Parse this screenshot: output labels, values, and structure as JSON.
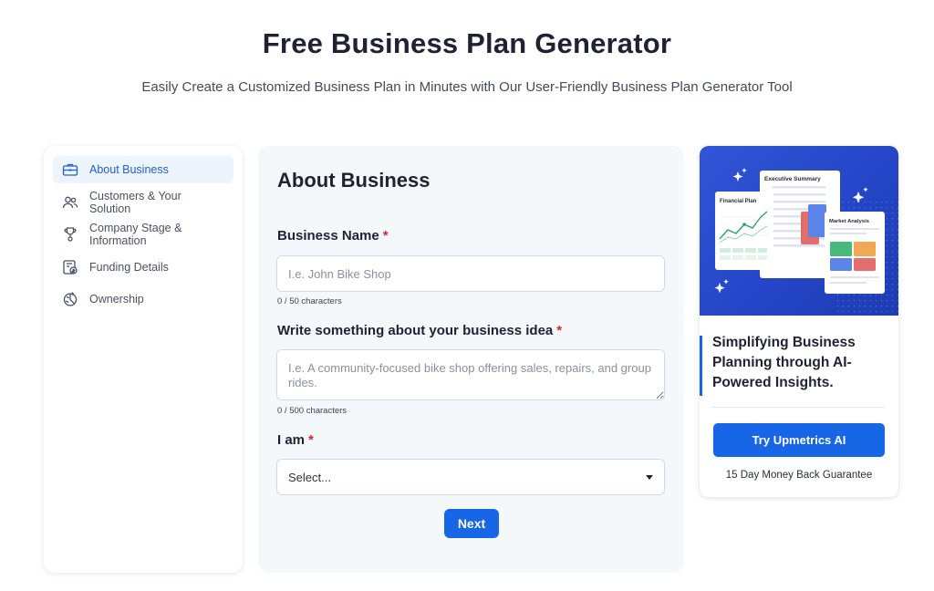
{
  "header": {
    "title": "Free Business Plan Generator",
    "subtitle": "Easily Create a Customized Business Plan in Minutes with Our User-Friendly Business Plan Generator Tool"
  },
  "sidebar": {
    "items": [
      {
        "label": "About Business",
        "icon": "briefcase-icon",
        "active": true
      },
      {
        "label": "Customers & Your Solution",
        "icon": "users-icon",
        "active": false
      },
      {
        "label": "Company Stage & Information",
        "icon": "trophy-icon",
        "active": false
      },
      {
        "label": "Funding Details",
        "icon": "funding-icon",
        "active": false
      },
      {
        "label": "Ownership",
        "icon": "ownership-icon",
        "active": false
      }
    ]
  },
  "form": {
    "title": "About Business",
    "required_marker": "*",
    "business_name": {
      "label": "Business Name",
      "placeholder": "I.e. John Bike Shop",
      "value": "",
      "counter": "0 / 50 characters"
    },
    "business_idea": {
      "label": "Write something about your business idea",
      "placeholder": "I.e. A community-focused bike shop offering sales, repairs, and group rides.",
      "value": "",
      "counter": "0 / 500 characters"
    },
    "i_am": {
      "label": "I am",
      "selected": "Select..."
    },
    "next_label": "Next"
  },
  "promo": {
    "illustration": {
      "executive_summary": "Executive Summary",
      "financial_plan": "Financial Plan",
      "market_analysis": "Market Analysis"
    },
    "heading": "Simplifying Business Planning through AI-Powered Insights.",
    "button_label": "Try Upmetrics AI",
    "guarantee": "15 Day Money Back Guarantee"
  },
  "colors": {
    "accent": "#1766e6",
    "required": "#d12b2b",
    "active_nav_bg": "#eef4fb",
    "promo_bg": "#2446c7"
  }
}
